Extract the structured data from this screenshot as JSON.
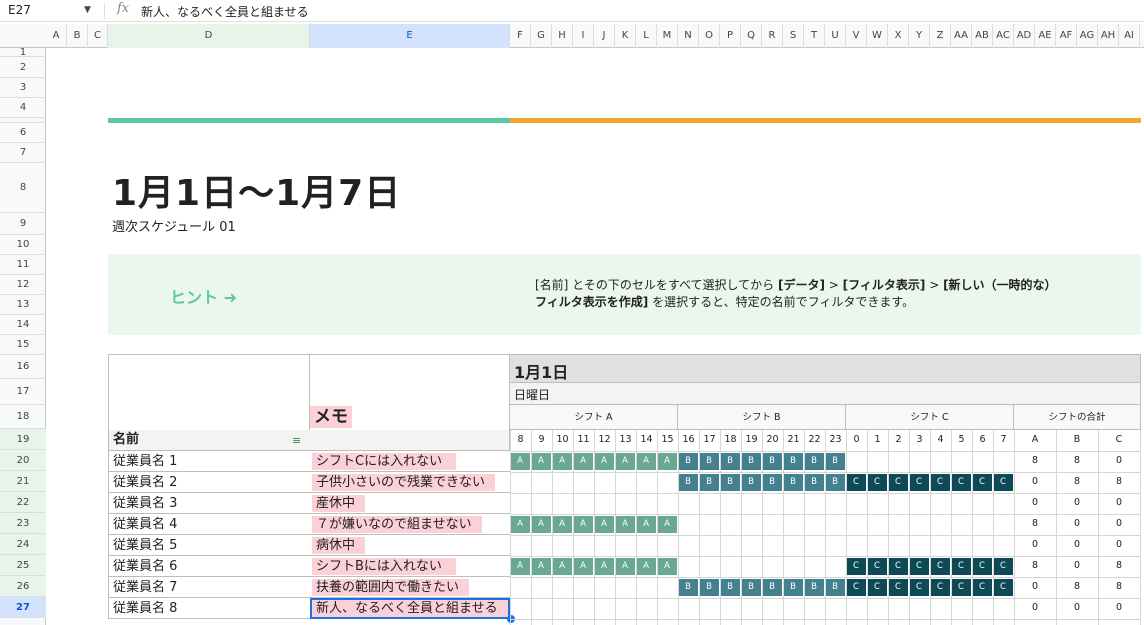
{
  "formula_bar": {
    "cell_ref": "E27",
    "fx_label": "fx",
    "formula": "新人、なるべく全員と組ませる"
  },
  "columns": [
    "A",
    "B",
    "C",
    "D",
    "E",
    "F",
    "G",
    "H",
    "I",
    "J",
    "K",
    "L",
    "M",
    "N",
    "O",
    "P",
    "Q",
    "R",
    "S",
    "T",
    "U",
    "V",
    "W",
    "X",
    "Y",
    "Z",
    "AA",
    "AB",
    "AC",
    "AD",
    "AE",
    "AF",
    "AG",
    "AH",
    "AI"
  ],
  "rows": [
    "1",
    "2",
    "3",
    "4",
    "5",
    "6",
    "7",
    "8",
    "9",
    "10",
    "11",
    "12",
    "13",
    "14",
    "15",
    "16",
    "17",
    "18",
    "19",
    "20",
    "21",
    "22",
    "23",
    "24",
    "25",
    "26",
    "27"
  ],
  "title": "1月1日〜1月7日",
  "subtitle": "週次スケジュール 01",
  "hint": {
    "label": "ヒント ➜",
    "line1_a": "[名前] とその下のセルをすべて選択してから ",
    "line1_b": "[データ]",
    "line1_c": " > ",
    "line1_d": "[フィルタ表示]",
    "line1_e": " > ",
    "line1_f": "[新しい（一時的な）",
    "line2_a": "フィルタ表示を作成]",
    "line2_b": " を選択すると、特定の名前でフィルタできます。"
  },
  "table": {
    "memo_header": "メモ",
    "name_header": "名前",
    "date": "1月1日",
    "weekday": "日曜日",
    "shift_a": "シフト A",
    "shift_b": "シフト B",
    "shift_c": "シフト C",
    "shift_total": "シフトの合計",
    "hours": [
      "8",
      "9",
      "10",
      "11",
      "12",
      "13",
      "14",
      "15",
      "16",
      "17",
      "18",
      "19",
      "20",
      "21",
      "22",
      "23",
      "0",
      "1",
      "2",
      "3",
      "4",
      "5",
      "6",
      "7"
    ],
    "totals_headers": [
      "A",
      "B",
      "C"
    ],
    "employees": [
      {
        "name": "従業員名 1",
        "memo": "シフトCには入れない",
        "shifts": "AAAAAAAABBBBBBBB........",
        "totals": [
          "8",
          "8",
          "0"
        ]
      },
      {
        "name": "従業員名 2",
        "memo": "子供小さいので残業できない",
        "shifts": "........BBBBBBBBCCCCCCCC",
        "totals": [
          "0",
          "8",
          "8"
        ]
      },
      {
        "name": "従業員名 3",
        "memo": "産休中",
        "shifts": "........................",
        "totals": [
          "0",
          "0",
          "0"
        ]
      },
      {
        "name": "従業員名 4",
        "memo": "７が嫌いなので組ませない",
        "shifts": "AAAAAAAA................",
        "totals": [
          "8",
          "0",
          "0"
        ]
      },
      {
        "name": "従業員名 5",
        "memo": "病休中",
        "shifts": "........................",
        "totals": [
          "0",
          "0",
          "0"
        ]
      },
      {
        "name": "従業員名 6",
        "memo": "シフトBには入れない",
        "shifts": "AAAAAAAA........CCCCCCCC",
        "totals": [
          "8",
          "0",
          "8"
        ]
      },
      {
        "name": "従業員名 7",
        "memo": "扶養の範囲内で働きたい",
        "shifts": "........BBBBBBBBCCCCCCCC",
        "totals": [
          "0",
          "8",
          "8"
        ]
      },
      {
        "name": "従業員名 8",
        "memo": "新人、なるべく全員と組ませる",
        "shifts": "........................",
        "totals": [
          "0",
          "0",
          "0"
        ]
      }
    ]
  },
  "colors": {
    "green_bar": "#5ec7a5",
    "orange_bar": "#f0a92d",
    "shift_a": "#6aa895",
    "shift_b": "#44818f",
    "shift_c": "#0d4a56",
    "hint_bg": "#ebf7ec"
  }
}
